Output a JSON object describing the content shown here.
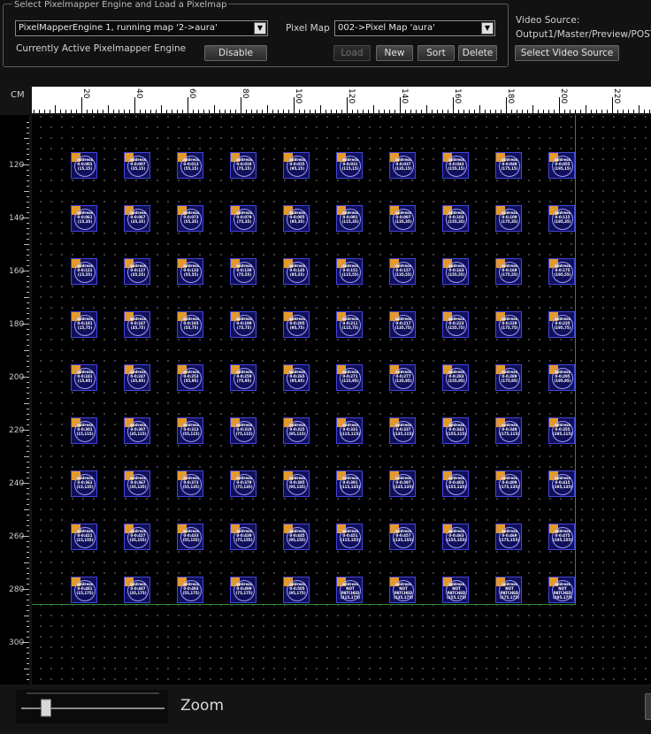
{
  "engine_group": {
    "title": "Select Pixelmapper Engine and Load a Pixelmap",
    "engine_select_value": "PixelMapperEngine 1, running map '2->aura'",
    "active_engine_label": "Currently Active Pixelmapper Engine",
    "disable_label": "Disable"
  },
  "pixel_map": {
    "label": "Pixel Map",
    "select_value": "002->Pixel Map 'aura'",
    "buttons": {
      "load": "Load",
      "new": "New",
      "sort": "Sort",
      "delete": "Delete"
    }
  },
  "video_source": {
    "label": "Video Source:",
    "value": "Output1/Master/Preview/POST",
    "button": "Select Video Source"
  },
  "viewport": {
    "unit_label": "CM",
    "x_ticks": [
      "20",
      "40",
      "60",
      "80",
      "100",
      "120",
      "140",
      "160",
      "180",
      "200",
      "220"
    ],
    "y_ticks": [
      "120",
      "140",
      "160",
      "180",
      "200",
      "220",
      "240",
      "260",
      "280",
      "300"
    ]
  },
  "fixture_grid": {
    "rows": [
      {
        "y": "15",
        "addresses": [
          "0-0:001",
          "0-0:007",
          "0-0:013",
          "0-0:019",
          "0-0:025",
          "0-0:031",
          "0-0:037",
          "0-0:043",
          "0-0:049",
          "0-0:055"
        ]
      },
      {
        "y": "35",
        "addresses": [
          "0-0:061",
          "0-0:067",
          "0-0:073",
          "0-0:079",
          "0-0:085",
          "0-0:091",
          "0-0:097",
          "0-0:103",
          "0-0:109",
          "0-0:115"
        ]
      },
      {
        "y": "55",
        "addresses": [
          "0-0:121",
          "0-0:127",
          "0-0:133",
          "0-0:139",
          "0-0:145",
          "0-0:151",
          "0-0:157",
          "0-0:163",
          "0-0:169",
          "0-0:175"
        ]
      },
      {
        "y": "75",
        "addresses": [
          "0-0:181",
          "0-0:187",
          "0-0:193",
          "0-0:199",
          "0-0:205",
          "0-0:211",
          "0-0:217",
          "0-0:223",
          "0-0:229",
          "0-0:235"
        ]
      },
      {
        "y": "95",
        "addresses": [
          "0-0:241",
          "0-0:247",
          "0-0:253",
          "0-0:259",
          "0-0:265",
          "0-0:271",
          "0-0:277",
          "0-0:283",
          "0-0:289",
          "0-0:295"
        ]
      },
      {
        "y": "115",
        "addresses": [
          "0-0:301",
          "0-0:307",
          "0-0:313",
          "0-0:319",
          "0-0:325",
          "0-0:331",
          "0-0:337",
          "0-0:343",
          "0-0:349",
          "0-0:355"
        ]
      },
      {
        "y": "135",
        "addresses": [
          "0-0:361",
          "0-0:367",
          "0-0:373",
          "0-0:379",
          "0-0:385",
          "0-0:391",
          "0-0:397",
          "0-0:403",
          "0-0:409",
          "0-0:415"
        ]
      },
      {
        "y": "155",
        "addresses": [
          "0-0:421",
          "0-0:427",
          "0-0:433",
          "0-0:439",
          "0-0:445",
          "0-0:451",
          "0-0:457",
          "0-0:463",
          "0-0:469",
          "0-0:475"
        ]
      },
      {
        "y": "175",
        "addresses": [
          "0-0:481",
          "0-0:487",
          "0-0:493",
          "0-0:499",
          "0-0:505",
          "NOT PATCHED",
          "NOT PATCHED",
          "NOT PATCHED",
          "NOT PATCHED",
          "NOT PATCHED"
        ]
      }
    ],
    "x_values": [
      "15",
      "35",
      "55",
      "75",
      "95",
      "115",
      "135",
      "155",
      "175",
      "195"
    ],
    "heading": "address"
  },
  "zoom": {
    "label": "Zoom",
    "level": 0.15
  },
  "colors": {
    "fixture_fill": "#10105a",
    "fixture_border": "#4444dd",
    "corner_accent": "#e39a2a",
    "boundary": "#2f8f2f"
  }
}
